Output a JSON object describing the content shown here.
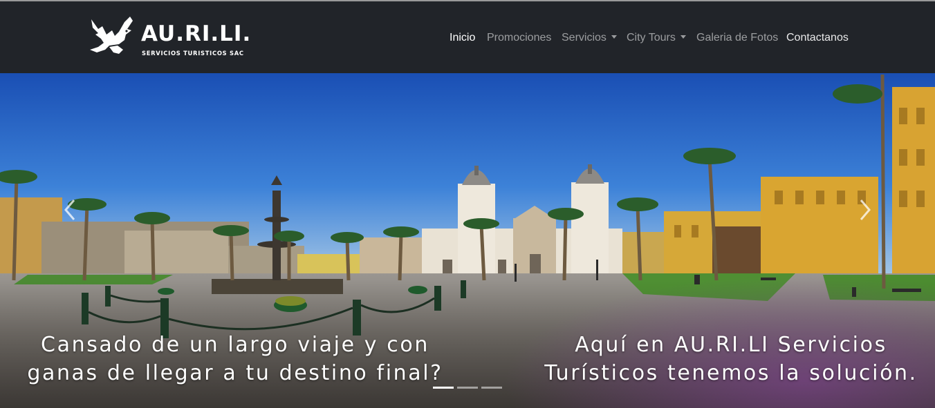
{
  "brand": {
    "name": "AU.RI.LI.",
    "tagline": "SERVICIOS TURISTICOS SAC",
    "logo_icon": "eagle-icon"
  },
  "nav": {
    "items": [
      {
        "label": "Inicio",
        "active": true,
        "dropdown": false
      },
      {
        "label": "Promociones",
        "active": false,
        "dropdown": false
      },
      {
        "label": "Servicios",
        "active": false,
        "dropdown": true
      },
      {
        "label": "City Tours",
        "active": false,
        "dropdown": true
      },
      {
        "label": "Galeria de Fotos",
        "active": false,
        "dropdown": false
      },
      {
        "label": "Contactanos",
        "active": false,
        "dropdown": false
      }
    ]
  },
  "carousel": {
    "caption_left": [
      "Cansado de un largo viaje y con",
      "ganas de llegar a tu destino final?"
    ],
    "caption_right": [
      "Aquí en AU.RI.LI Servicios",
      "Turísticos tenemos la solución."
    ],
    "slide_count": 3,
    "active_slide": 1,
    "prev_icon": "chevron-left-icon",
    "next_icon": "chevron-right-icon"
  },
  "colors": {
    "navbar_bg": "#212429",
    "sky_top": "#1f56b8",
    "building_yellow": "#d9a531",
    "cathedral": "#e9e2d4"
  }
}
